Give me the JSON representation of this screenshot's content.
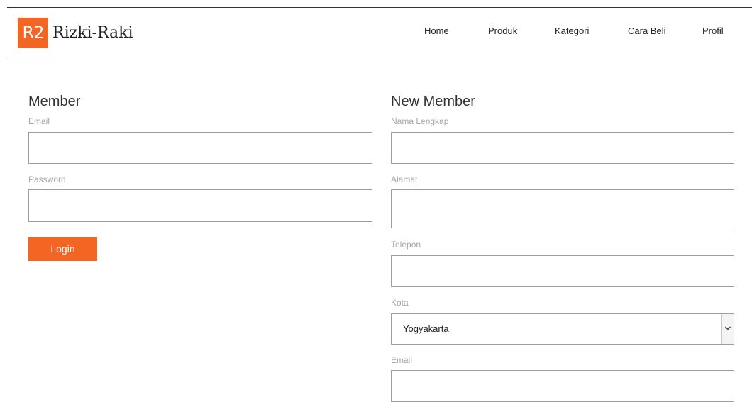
{
  "header": {
    "logo_mark": "R2",
    "logo_text": "Rizki-Raki",
    "nav": {
      "home": "Home",
      "produk": "Produk",
      "kategori": "Kategori",
      "cara_beli": "Cara Beli",
      "profil": "Profil"
    }
  },
  "member": {
    "title": "Member",
    "email_label": "Email",
    "email_value": "",
    "password_label": "Password",
    "password_value": "",
    "login_label": "Login"
  },
  "new_member": {
    "title": "New Member",
    "nama_label": "Nama Lengkap",
    "nama_value": "",
    "alamat_label": "Alamat",
    "alamat_value": "",
    "telepon_label": "Telepon",
    "telepon_value": "",
    "kota_label": "Kota",
    "kota_selected": "Yogyakarta",
    "email_label": "Email",
    "email_value": ""
  },
  "colors": {
    "accent": "#f26522",
    "label": "#a6a6a6",
    "border": "#9e9e9e"
  },
  "icons": {
    "select_arrow": "chevron-down-icon"
  }
}
